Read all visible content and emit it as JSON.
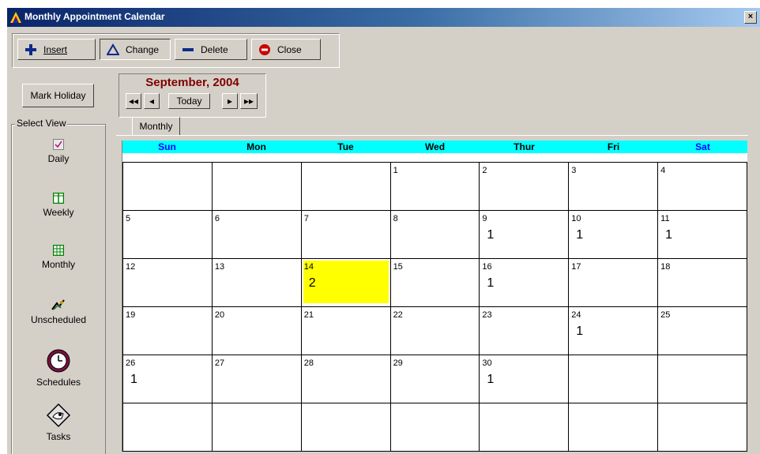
{
  "window": {
    "title": "Monthly Appointment Calendar",
    "close_label": "×"
  },
  "toolbar": {
    "insert_label": "Insert",
    "change_label": "Change",
    "delete_label": "Delete",
    "close_label": "Close"
  },
  "mark_holiday_label": "Mark Holiday",
  "select_view": {
    "label": "Select View",
    "items": [
      {
        "label": "Daily",
        "icon": "daily-icon"
      },
      {
        "label": "Weekly",
        "icon": "weekly-icon"
      },
      {
        "label": "Monthly",
        "icon": "monthly-icon"
      },
      {
        "label": "Unscheduled",
        "icon": "unscheduled-icon"
      },
      {
        "label": "Schedules",
        "icon": "clock-icon"
      },
      {
        "label": "Tasks",
        "icon": "tasks-icon"
      }
    ]
  },
  "nav": {
    "month_title": "September, 2004",
    "first_label": "◂◂",
    "prev_label": "◂",
    "today_label": "Today",
    "next_label": "▸",
    "last_label": "▸▸"
  },
  "tab": {
    "label": "Monthly"
  },
  "calendar": {
    "days": [
      "Sun",
      "Mon",
      "Tue",
      "Wed",
      "Thur",
      "Fri",
      "Sat"
    ],
    "weeks": [
      [
        {
          "d": ""
        },
        {
          "d": ""
        },
        {
          "d": ""
        },
        {
          "d": "1"
        },
        {
          "d": "2"
        },
        {
          "d": "3"
        },
        {
          "d": "4"
        }
      ],
      [
        {
          "d": "5"
        },
        {
          "d": "6"
        },
        {
          "d": "7"
        },
        {
          "d": "8"
        },
        {
          "d": "9",
          "c": "1"
        },
        {
          "d": "10",
          "c": "1"
        },
        {
          "d": "11",
          "c": "1"
        }
      ],
      [
        {
          "d": "12"
        },
        {
          "d": "13"
        },
        {
          "d": "14",
          "c": "2",
          "today": true
        },
        {
          "d": "15"
        },
        {
          "d": "16",
          "c": "1"
        },
        {
          "d": "17"
        },
        {
          "d": "18"
        }
      ],
      [
        {
          "d": "19"
        },
        {
          "d": "20"
        },
        {
          "d": "21"
        },
        {
          "d": "22"
        },
        {
          "d": "23"
        },
        {
          "d": "24",
          "c": "1"
        },
        {
          "d": "25"
        }
      ],
      [
        {
          "d": "26",
          "c": "1"
        },
        {
          "d": "27"
        },
        {
          "d": "28"
        },
        {
          "d": "29"
        },
        {
          "d": "30",
          "c": "1"
        },
        {
          "d": ""
        },
        {
          "d": ""
        }
      ],
      [
        {
          "d": ""
        },
        {
          "d": ""
        },
        {
          "d": ""
        },
        {
          "d": ""
        },
        {
          "d": ""
        },
        {
          "d": ""
        },
        {
          "d": ""
        }
      ]
    ]
  },
  "colors": {
    "header_bg": "#00ffff",
    "weekend_text": "#0000ff",
    "today_bg": "#ffff00",
    "month_title": "#800000"
  }
}
